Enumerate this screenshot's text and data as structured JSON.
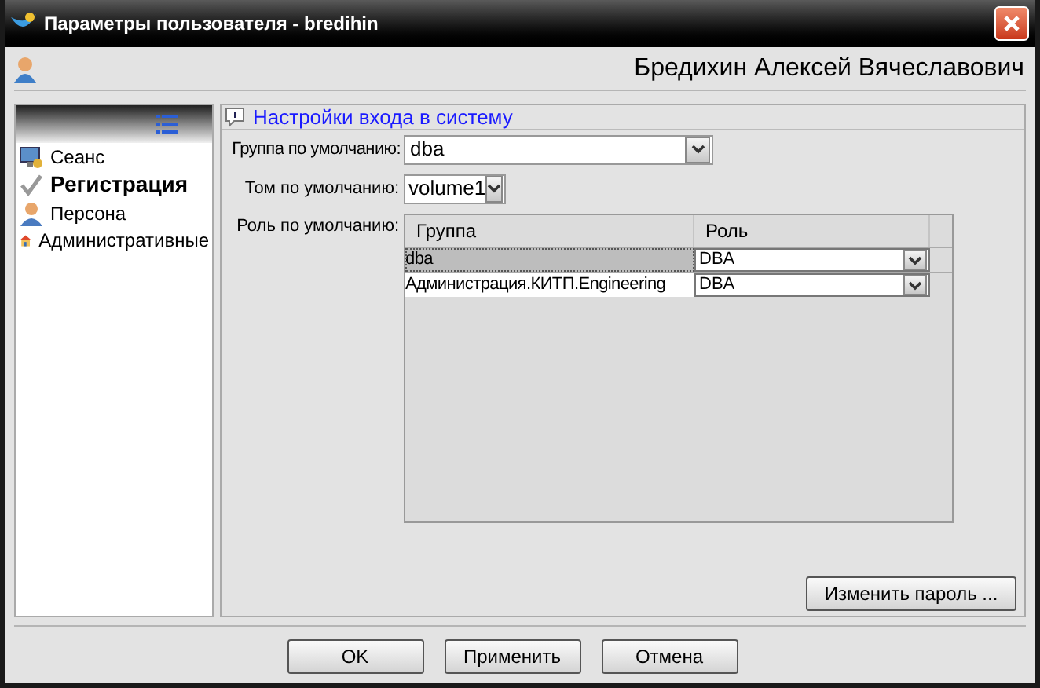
{
  "window": {
    "title": "Параметры пользователя  -  bredihin"
  },
  "header": {
    "user_name": "Бредихин Алексей Вячеславович"
  },
  "sidebar": {
    "items": [
      {
        "label": "Сеанс",
        "selected": false
      },
      {
        "label": "Регистрация",
        "selected": true
      },
      {
        "label": "Персона",
        "selected": false
      },
      {
        "label": "Административные",
        "selected": false
      }
    ]
  },
  "section": {
    "title": "Настройки входа в систему"
  },
  "form": {
    "group": {
      "label": "Группа по умолчанию:",
      "value": "dba"
    },
    "volume": {
      "label": "Том по умолчанию:",
      "value": "volume1"
    },
    "role": {
      "label": "Роль по умолчанию:"
    }
  },
  "table": {
    "columns": [
      "Группа",
      "Роль"
    ],
    "rows": [
      {
        "group": "dba",
        "role": "DBA",
        "selected": true
      },
      {
        "group": "Администрация.КИТП.Engineering",
        "role": "DBA",
        "selected": false
      }
    ]
  },
  "change_password_button": "Изменить пароль ...",
  "buttons": [
    "OK",
    "Применить",
    "Отмена"
  ]
}
